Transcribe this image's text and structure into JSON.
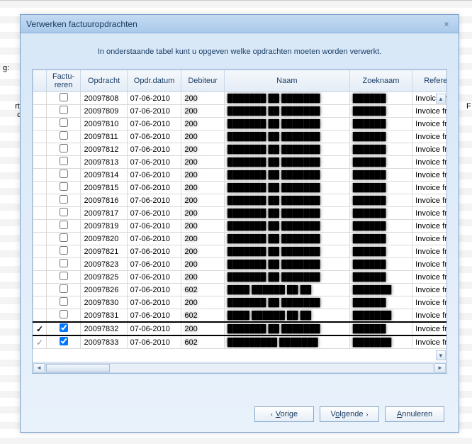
{
  "dialog": {
    "title": "Verwerken factuuropdrachten",
    "close_label": "×",
    "instruction": "In onderstaande tabel kunt u opgeven welke opdrachten moeten worden verwerkt."
  },
  "background": {
    "label_g": "g:",
    "label_artikelcode": "rtikel-\ncode",
    "label_f": "F"
  },
  "columns": {
    "mark": "",
    "factureren": "Factu-\nreren",
    "opdracht": "Opdracht",
    "opdr_datum": "Opdr.datum",
    "debiteur": "Debiteur",
    "naam": "Naam",
    "zoeknaam": "Zoeknaam",
    "referentie": "Referentie"
  },
  "rows": [
    {
      "mark": "",
      "checked": false,
      "opdracht": "20097808",
      "datum": "07-06-2010",
      "debiteur": "200",
      "naam": "███████ ██ ███████",
      "zoek": "██████",
      "ref": "Invoice from"
    },
    {
      "mark": "",
      "checked": false,
      "opdracht": "20097809",
      "datum": "07-06-2010",
      "debiteur": "200",
      "naam": "███████ ██ ███████",
      "zoek": "██████",
      "ref": "Invoice from"
    },
    {
      "mark": "",
      "checked": false,
      "opdracht": "20097810",
      "datum": "07-06-2010",
      "debiteur": "200",
      "naam": "███████ ██ ███████",
      "zoek": "██████",
      "ref": "Invoice from"
    },
    {
      "mark": "",
      "checked": false,
      "opdracht": "20097811",
      "datum": "07-06-2010",
      "debiteur": "200",
      "naam": "███████ ██ ███████",
      "zoek": "██████",
      "ref": "Invoice from"
    },
    {
      "mark": "",
      "checked": false,
      "opdracht": "20097812",
      "datum": "07-06-2010",
      "debiteur": "200",
      "naam": "███████ ██ ███████",
      "zoek": "██████",
      "ref": "Invoice from"
    },
    {
      "mark": "",
      "checked": false,
      "opdracht": "20097813",
      "datum": "07-06-2010",
      "debiteur": "200",
      "naam": "███████ ██ ███████",
      "zoek": "██████",
      "ref": "Invoice from"
    },
    {
      "mark": "",
      "checked": false,
      "opdracht": "20097814",
      "datum": "07-06-2010",
      "debiteur": "200",
      "naam": "███████ ██ ███████",
      "zoek": "██████",
      "ref": "Invoice from"
    },
    {
      "mark": "",
      "checked": false,
      "opdracht": "20097815",
      "datum": "07-06-2010",
      "debiteur": "200",
      "naam": "███████ ██ ███████",
      "zoek": "██████",
      "ref": "Invoice from"
    },
    {
      "mark": "",
      "checked": false,
      "opdracht": "20097816",
      "datum": "07-06-2010",
      "debiteur": "200",
      "naam": "███████ ██ ███████",
      "zoek": "██████",
      "ref": "Invoice from"
    },
    {
      "mark": "",
      "checked": false,
      "opdracht": "20097817",
      "datum": "07-06-2010",
      "debiteur": "200",
      "naam": "███████ ██ ███████",
      "zoek": "██████",
      "ref": "Invoice from"
    },
    {
      "mark": "",
      "checked": false,
      "opdracht": "20097819",
      "datum": "07-06-2010",
      "debiteur": "200",
      "naam": "███████ ██ ███████",
      "zoek": "██████",
      "ref": "Invoice from"
    },
    {
      "mark": "",
      "checked": false,
      "opdracht": "20097820",
      "datum": "07-06-2010",
      "debiteur": "200",
      "naam": "███████ ██ ███████",
      "zoek": "██████",
      "ref": "Invoice from"
    },
    {
      "mark": "",
      "checked": false,
      "opdracht": "20097821",
      "datum": "07-06-2010",
      "debiteur": "200",
      "naam": "███████ ██ ███████",
      "zoek": "██████",
      "ref": "Invoice from"
    },
    {
      "mark": "",
      "checked": false,
      "opdracht": "20097823",
      "datum": "07-06-2010",
      "debiteur": "200",
      "naam": "███████ ██ ███████",
      "zoek": "██████",
      "ref": "Invoice from"
    },
    {
      "mark": "",
      "checked": false,
      "opdracht": "20097825",
      "datum": "07-06-2010",
      "debiteur": "200",
      "naam": "███████ ██ ███████",
      "zoek": "██████",
      "ref": "Invoice from"
    },
    {
      "mark": "",
      "checked": false,
      "opdracht": "20097826",
      "datum": "07-06-2010",
      "debiteur": "602",
      "naam": "████ ██████ ██ ██",
      "zoek": "███████",
      "ref": "Invoice from"
    },
    {
      "mark": "",
      "checked": false,
      "opdracht": "20097830",
      "datum": "07-06-2010",
      "debiteur": "200",
      "naam": "███████ ██ ███████",
      "zoek": "██████",
      "ref": "Invoice from"
    },
    {
      "mark": "",
      "checked": false,
      "opdracht": "20097831",
      "datum": "07-06-2010",
      "debiteur": "602",
      "naam": "████ ██████ ██ ██",
      "zoek": "███████",
      "ref": "Invoice from"
    },
    {
      "mark": "tick",
      "checked": true,
      "opdracht": "20097832",
      "datum": "07-06-2010",
      "debiteur": "200",
      "naam": "███████ ██ ███████",
      "zoek": "██████",
      "ref": "Invoice from",
      "selected": true
    },
    {
      "mark": "dim",
      "checked": true,
      "opdracht": "20097833",
      "datum": "07-06-2010",
      "debiteur": "602",
      "naam": "█████████ ███████",
      "zoek": "███████",
      "ref": "Invoice from"
    }
  ],
  "buttons": {
    "prev_chevron": "‹",
    "prev_label": "Vorige",
    "prev_hotkey": "V",
    "next_label": "Volgende",
    "next_hotkey": "o",
    "next_chevron": "›",
    "cancel_label": "Annuleren",
    "cancel_hotkey": "A"
  }
}
